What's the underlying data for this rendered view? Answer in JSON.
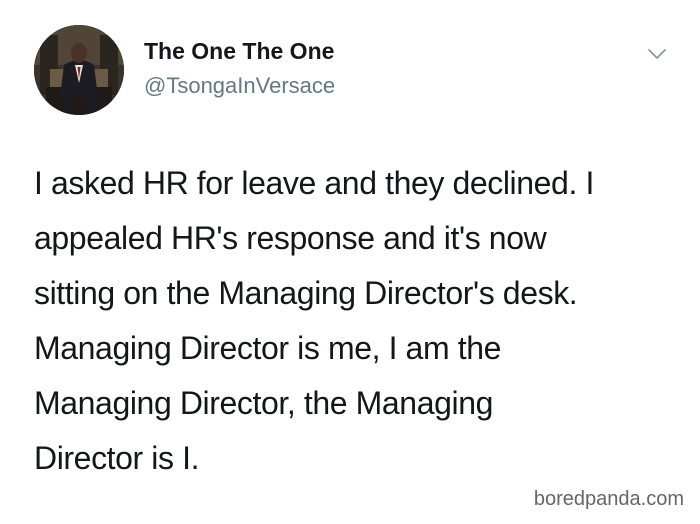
{
  "author": {
    "display_name": "The One The One",
    "handle": "@TsongaInVersace",
    "avatar_icon": "profile-photo-man-in-suit-seated"
  },
  "menu": {
    "icon": "chevron-down-icon"
  },
  "tweet": {
    "lines": [
      "I asked HR for leave and they declined. I",
      "appealed HR's response and it's now",
      "sitting on the Managing Director's desk.",
      "Managing Director is me, I am the",
      "Managing Director, the Managing",
      "Director is I."
    ]
  },
  "watermark": {
    "text": "boredpanda.com"
  },
  "colors": {
    "text": "#14171a",
    "handle": "#657786",
    "watermark": "#666666",
    "background": "#ffffff"
  }
}
